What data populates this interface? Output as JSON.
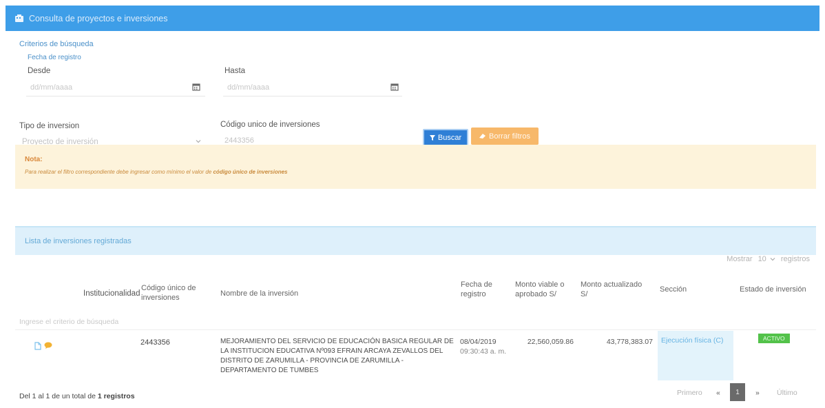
{
  "header": {
    "title": "Consulta de proyectos e inversiones"
  },
  "criteria": {
    "title": "Criterios de búsqueda",
    "date_group_label": "Fecha de registro",
    "from_label": "Desde",
    "from_placeholder": "dd/mm/aaaa",
    "to_label": "Hasta",
    "to_placeholder": "dd/mm/aaaa"
  },
  "filters": {
    "type_label": "Tipo de inversion",
    "type_value": "Proyecto de inversión",
    "code_label": "Código unico de inversiones",
    "code_value": "2443356",
    "search_button": "Buscar",
    "clear_button": "Borrar filtros"
  },
  "note": {
    "title": "Nota:",
    "text_prefix": "Para realizar el filtro correspondiente debe ingresar como mínimo el valor de",
    "text_bold": "código único de inversiones"
  },
  "list": {
    "title": "Lista de inversiones registradas",
    "show_label": "Mostrar",
    "show_value": "10",
    "show_suffix": "registros",
    "columns": {
      "institucionalidad": "Institucionalidad",
      "codigo": "Código único de inversiones",
      "nombre": "Nombre de la inversión",
      "fecha": "Fecha de registro",
      "monto_viable": "Monto viable o aprobado S/",
      "monto_actualizado": "Monto actualizado S/",
      "seccion": "Sección",
      "estado": "Estado de inversión"
    },
    "search_hint": "Ingrese el criterio de búsqueda",
    "rows": [
      {
        "codigo": "2443356",
        "nombre": "MEJORAMIENTO DEL SERVICIO DE EDUCACIÓN BASICA REGULAR DE LA INSTITUCION EDUCATIVA Nº093 EFRAIN ARCAYA ZEVALLOS DEL DISTRITO DE ZARUMILLA - PROVINCIA DE ZARUMILLA - DEPARTAMENTO DE TUMBES",
        "fecha": "08/04/2019",
        "hora": "09:30:43 a. m.",
        "monto_viable": "22,560,059.86",
        "monto_actualizado": "43,778,383.07",
        "seccion": "Ejecución física (C)",
        "estado": "ACTIVO"
      }
    ],
    "footer_prefix": "Del 1 al 1 de un total de",
    "footer_bold": "1 registros",
    "pager": {
      "first": "Primero",
      "prev": "«",
      "current": "1",
      "next": "»",
      "last": "Último"
    }
  },
  "colors": {
    "header": "#3e9ee8",
    "primary": "#2f7fd6",
    "warning": "#f7b86a",
    "success": "#53c24a"
  }
}
